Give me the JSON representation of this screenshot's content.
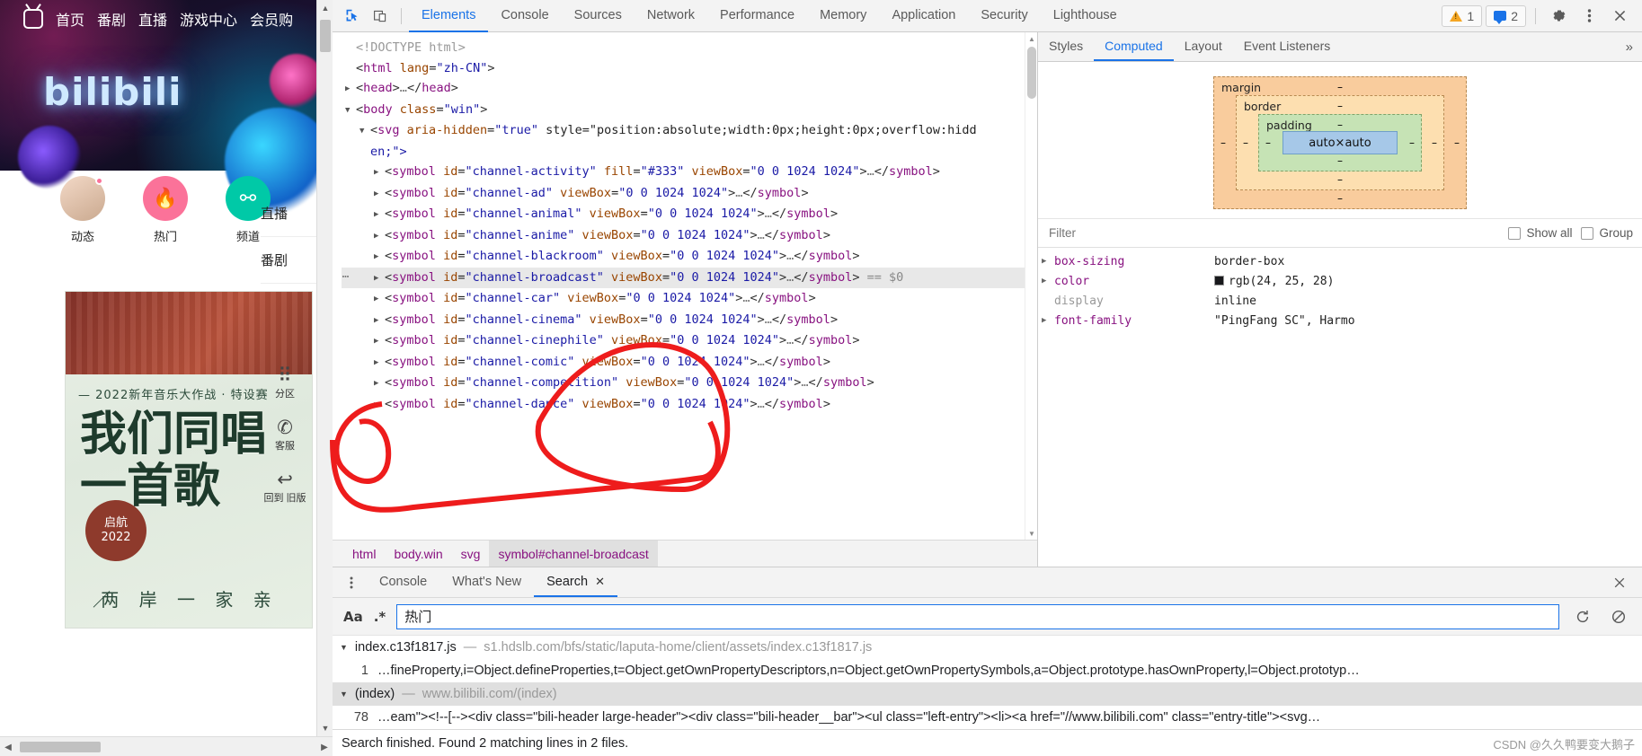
{
  "website": {
    "nav": [
      "首页",
      "番剧",
      "直播",
      "游戏中心",
      "会员购"
    ],
    "wordmark": "bilibili",
    "icon_row": [
      {
        "label": "动态",
        "icon": "avatar-icon"
      },
      {
        "label": "热门",
        "icon": "flame-icon"
      },
      {
        "label": "频道",
        "icon": "channel-icon"
      }
    ],
    "side_list": [
      "直播",
      "番剧"
    ],
    "card": {
      "subtitle": "— 2022新年音乐大作战 · 特设赛",
      "line1": "我们同唱",
      "line2": "一首歌",
      "seal_line1": "启航",
      "seal_line2": "2022",
      "footer": "两 岸 一 家 亲",
      "slash": "／"
    },
    "right_rail": [
      {
        "glyph": "⠿",
        "label": "分区"
      },
      {
        "glyph": "✆",
        "label": "客服"
      },
      {
        "glyph": "↩",
        "label": "回到\n旧版"
      }
    ]
  },
  "devtools": {
    "toolbar": {
      "inspect_icon": "inspect-element-icon",
      "device_icon": "device-toolbar-icon",
      "tabs": [
        "Elements",
        "Console",
        "Sources",
        "Network",
        "Performance",
        "Memory",
        "Application",
        "Security",
        "Lighthouse"
      ],
      "active_tab": "Elements",
      "warning_count": "1",
      "message_count": "2",
      "settings_icon": "gear-icon",
      "more_icon": "kebab-menu-icon",
      "close_icon": "close-icon"
    },
    "dom": [
      {
        "indent": 0,
        "tri": "",
        "text": "<!DOCTYPE html>",
        "kind": "doctype"
      },
      {
        "indent": 0,
        "tri": "",
        "text": "<html lang=\"zh-CN\">",
        "kind": "tag"
      },
      {
        "indent": 0,
        "tri": "▶",
        "text": "<head>…</head>",
        "kind": "tag"
      },
      {
        "indent": 0,
        "tri": "▼",
        "text": "<body class=\"win\">",
        "kind": "tag"
      },
      {
        "indent": 1,
        "tri": "▼",
        "text": "<svg aria-hidden=\"true\" style=\"position:absolute;width:0px;height:0px;overflow:hidd",
        "kind": "tag"
      },
      {
        "indent": 1,
        "tri": "",
        "text": "en;\">",
        "kind": "cont"
      },
      {
        "indent": 2,
        "tri": "▶",
        "text": "<symbol id=\"channel-activity\" fill=\"#333\" viewBox=\"0 0 1024 1024\">…</symbol>",
        "kind": "tag"
      },
      {
        "indent": 2,
        "tri": "▶",
        "text": "<symbol id=\"channel-ad\" viewBox=\"0 0 1024 1024\">…</symbol>",
        "kind": "tag"
      },
      {
        "indent": 2,
        "tri": "▶",
        "text": "<symbol id=\"channel-animal\" viewBox=\"0 0 1024 1024\">…</symbol>",
        "kind": "tag"
      },
      {
        "indent": 2,
        "tri": "▶",
        "text": "<symbol id=\"channel-anime\" viewBox=\"0 0 1024 1024\">…</symbol>",
        "kind": "tag"
      },
      {
        "indent": 2,
        "tri": "▶",
        "text": "<symbol id=\"channel-blackroom\" viewBox=\"0 0 1024 1024\">…</symbol>",
        "kind": "tag"
      },
      {
        "indent": 2,
        "tri": "▶",
        "text": "<symbol id=\"channel-broadcast\" viewBox=\"0 0 1024 1024\">…</symbol> == $0",
        "kind": "tag",
        "selected": true
      },
      {
        "indent": 2,
        "tri": "▶",
        "text": "<symbol id=\"channel-car\" viewBox=\"0 0 1024 1024\">…</symbol>",
        "kind": "tag"
      },
      {
        "indent": 2,
        "tri": "▶",
        "text": "<symbol id=\"channel-cinema\" viewBox=\"0 0 1024 1024\">…</symbol>",
        "kind": "tag"
      },
      {
        "indent": 2,
        "tri": "▶",
        "text": "<symbol id=\"channel-cinephile\" viewBox=\"0 0 1024 1024\">…</symbol>",
        "kind": "tag"
      },
      {
        "indent": 2,
        "tri": "▶",
        "text": "<symbol id=\"channel-comic\" viewBox=\"0 0 1024 1024\">…</symbol>",
        "kind": "tag"
      },
      {
        "indent": 2,
        "tri": "▶",
        "text": "<symbol id=\"channel-competition\" viewBox=\"0 0 1024 1024\">…</symbol>",
        "kind": "tag"
      },
      {
        "indent": 2,
        "tri": "▶",
        "text": "<symbol id=\"channel-dance\" viewBox=\"0 0 1024 1024\">…</symbol>",
        "kind": "tag"
      }
    ],
    "breadcrumb": [
      "html",
      "body.win",
      "svg",
      "symbol#channel-broadcast"
    ],
    "breadcrumb_active": "symbol#channel-broadcast",
    "sidebar": {
      "tabs": [
        "Styles",
        "Computed",
        "Layout",
        "Event Listeners"
      ],
      "active_tab": "Computed",
      "more_icon": "chevron-double-right-icon",
      "box_model": {
        "margin_label": "margin",
        "border_label": "border",
        "padding_label": "padding",
        "content": "auto×auto",
        "margin_values": {
          "top": "–",
          "right": "–",
          "bottom": "–",
          "left": "–"
        },
        "border_values": {
          "top": "–",
          "right": "–",
          "bottom": "–",
          "left": "–"
        },
        "padding_values": {
          "top": "–",
          "right": "–",
          "bottom": "–",
          "left": "–"
        }
      },
      "filter_placeholder": "Filter",
      "show_all_label": "Show all",
      "group_label": "Group",
      "computed": [
        {
          "tri": "▶",
          "name": "box-sizing",
          "value": "border-box",
          "swatch": null
        },
        {
          "tri": "▶",
          "name": "color",
          "value": "rgb(24, 25, 28)",
          "swatch": "#18191c"
        },
        {
          "tri": "",
          "name": "display",
          "value": "inline",
          "swatch": null,
          "gray": true
        },
        {
          "tri": "▶",
          "name": "font-family",
          "value": "\"PingFang SC\", Harmo",
          "swatch": null
        }
      ]
    },
    "drawer": {
      "menu_icon": "kebab-menu-icon",
      "tabs": [
        "Console",
        "What's New",
        "Search"
      ],
      "active_tab": "Search",
      "close_icon": "close-tab-icon",
      "panel_close_icon": "close-icon",
      "search": {
        "match_case_label": "Aa",
        "regex_label": ".*",
        "value": "热门",
        "refresh_icon": "refresh-icon",
        "clear_icon": "clear-icon"
      },
      "results": [
        {
          "tri": "▼",
          "file": "index.c13f1817.js",
          "dash": "—",
          "url": "s1.hdslb.com/bfs/static/laputa-home/client/assets/index.c13f1817.js",
          "highlight": false,
          "lines": [
            {
              "num": "1",
              "text": "…fineProperty,i=Object.defineProperties,t=Object.getOwnPropertyDescriptors,n=Object.getOwnPropertySymbols,a=Object.prototype.hasOwnProperty,l=Object.prototyp…"
            }
          ]
        },
        {
          "tri": "▼",
          "file": "(index)",
          "dash": "—",
          "url": "www.bilibili.com/(index)",
          "highlight": true,
          "lines": [
            {
              "num": "78",
              "text": "…eam\"><!--[--><div class=\"bili-header large-header\"><div class=\"bili-header__bar\"><ul class=\"left-entry\"><li><a href=\"//www.bilibili.com\" class=\"entry-title\"><svg…"
            }
          ]
        }
      ],
      "status": "Search finished. Found 2 matching lines in 2 files."
    }
  },
  "watermark": "CSDN @久久鸭要变大鹅子",
  "colors": {
    "accent": "#1a73e8",
    "selected_row": "#e8e8e8",
    "annotation": "#ee1c1c",
    "bili_pink": "#fb7299"
  }
}
